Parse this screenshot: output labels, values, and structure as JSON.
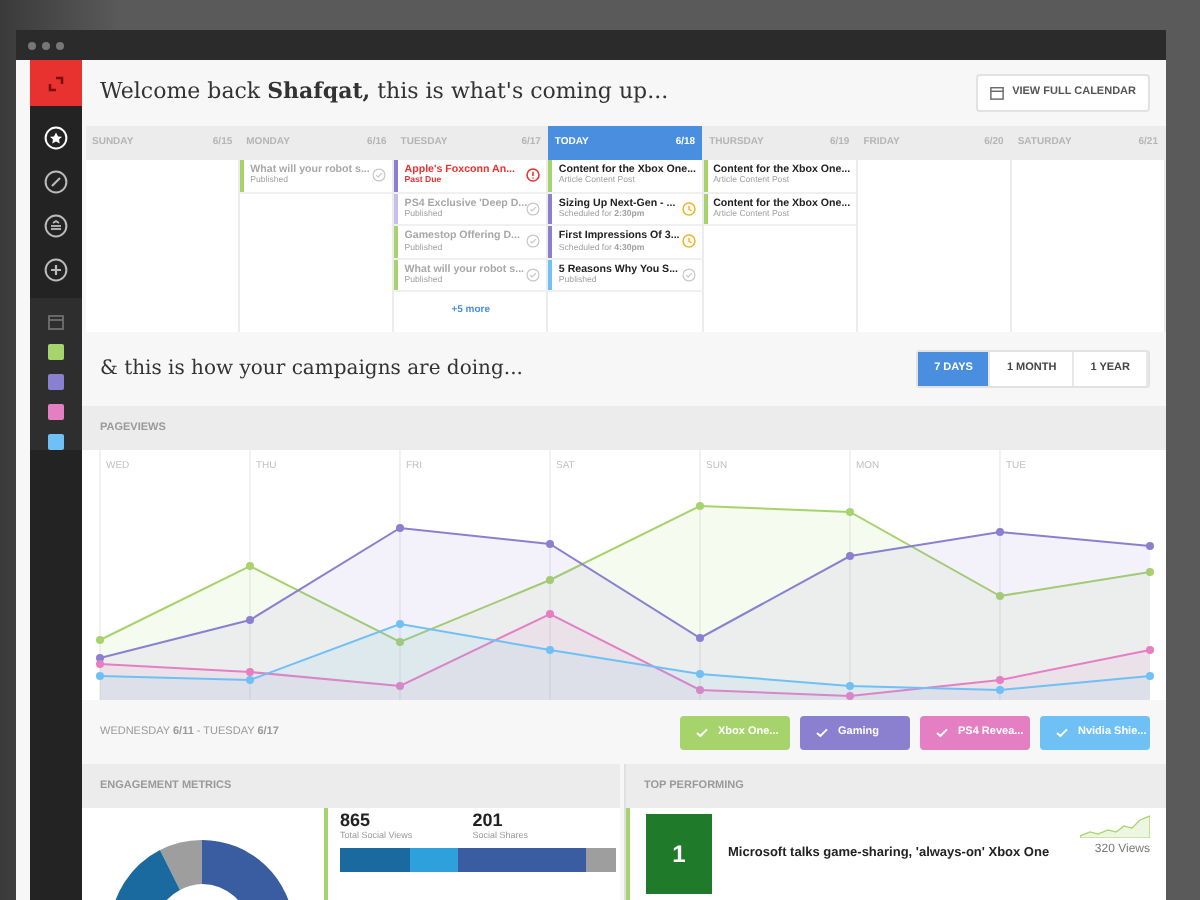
{
  "sidebar": {
    "nav": [
      {
        "kind": "home",
        "selected": true
      },
      {
        "kind": "edit",
        "selected": false
      },
      {
        "kind": "inbox",
        "selected": false
      },
      {
        "kind": "add",
        "selected": false
      }
    ],
    "campaigns": [
      {
        "color": "#a6d36b"
      },
      {
        "color": "#8b7fd0"
      },
      {
        "color": "#e47fc4"
      },
      {
        "color": "#6fc0f5"
      }
    ]
  },
  "header": {
    "greeting": "Welcome back **Shafqat,** this is what's coming up...",
    "button": "VIEW FULL CALENDAR"
  },
  "calendar": {
    "days": [
      {
        "name": "SUNDAY",
        "date": "6/15",
        "kind": "past"
      },
      {
        "name": "MONDAY",
        "date": "6/16",
        "kind": "past",
        "items": [
          {
            "title": "What will your robot s...",
            "subtitle": "Published",
            "color": "#a6d36b",
            "kind": "published"
          }
        ]
      },
      {
        "name": "TUESDAY",
        "date": "6/17",
        "kind": "past",
        "more": "+5 more",
        "items": [
          {
            "title": "Apple's Foxconn An...",
            "subtitle": "Past Due",
            "color": "#8b7fd0",
            "kind": "overdue"
          },
          {
            "title": "PS4 Exclusive 'Deep D...",
            "subtitle": "Published",
            "color": "#c7c0ec",
            "kind": "published"
          },
          {
            "title": "Gamestop Offering D...",
            "subtitle": "Published",
            "color": "#a6d36b",
            "kind": "published"
          },
          {
            "title": "What will your robot s...",
            "subtitle": "Published",
            "color": "#a6d36b",
            "kind": "published"
          }
        ]
      },
      {
        "name": "TODAY",
        "date": "6/18",
        "kind": "today",
        "items": [
          {
            "title": "Content for the Xbox One...",
            "subtitle": "Article Content Post",
            "color": "#a6d36b",
            "kind": "draft"
          },
          {
            "title": "Sizing Up Next-Gen - ...",
            "subtitle": "Scheduled for **2:30pm**",
            "color": "#8b7fd0",
            "kind": "scheduled"
          },
          {
            "title": "First Impressions Of 3...",
            "subtitle": "Scheduled for **4:30pm**",
            "color": "#8b7fd0",
            "kind": "scheduled"
          },
          {
            "title": "5 Reasons Why You S...",
            "subtitle": "Published",
            "color": "#6fc0f5",
            "kind": "published"
          }
        ]
      },
      {
        "name": "THURSDAY",
        "date": "6/19",
        "kind": "future",
        "items": [
          {
            "title": "Content for the Xbox One...",
            "subtitle": "Article Content Post",
            "color": "#a6d36b",
            "kind": "draft"
          },
          {
            "title": "Content for the Xbox One...",
            "subtitle": "Article Content Post",
            "color": "#a6d36b",
            "kind": "draft"
          }
        ]
      },
      {
        "name": "FRIDAY",
        "date": "6/20",
        "kind": "future"
      },
      {
        "name": "SATURDAY",
        "date": "6/21",
        "kind": "future"
      }
    ]
  },
  "campaigns": {
    "title": "& this is how your campaigns are doing...",
    "ranges": [
      {
        "label": "7 DAYS",
        "selected": true
      },
      {
        "label": "1 MONTH",
        "selected": false
      },
      {
        "label": "1 YEAR",
        "selected": false
      }
    ]
  },
  "pageviews": {
    "title": "PAGEVIEWS",
    "days": [
      "WED",
      "THU",
      "FRI",
      "SAT",
      "SUN",
      "MON",
      "TUE"
    ],
    "range": "WEDNESDAY **6/11** - TUESDAY **6/17**",
    "legend": [
      {
        "label": "Xbox One...",
        "color": "#a6d36b",
        "checked": true
      },
      {
        "label": "Gaming",
        "color": "#8b7fd0",
        "checked": true
      },
      {
        "label": "PS4 Revea...",
        "color": "#e47fc4",
        "checked": true
      },
      {
        "label": "Nvidia Shie...",
        "color": "#6fc0f5",
        "checked": true
      }
    ]
  },
  "engagement": {
    "title": "ENGAGEMENT METRICS",
    "stats": [
      {
        "value": "865",
        "label": "Total Social Views"
      },
      {
        "value": "201",
        "label": "Social Shares"
      }
    ]
  },
  "top_performing": {
    "title": "TOP PERFORMING",
    "items": [
      {
        "rank": "1",
        "title": "Microsoft talks game-sharing, 'always-on' Xbox One",
        "views": "320 Views"
      }
    ]
  }
}
